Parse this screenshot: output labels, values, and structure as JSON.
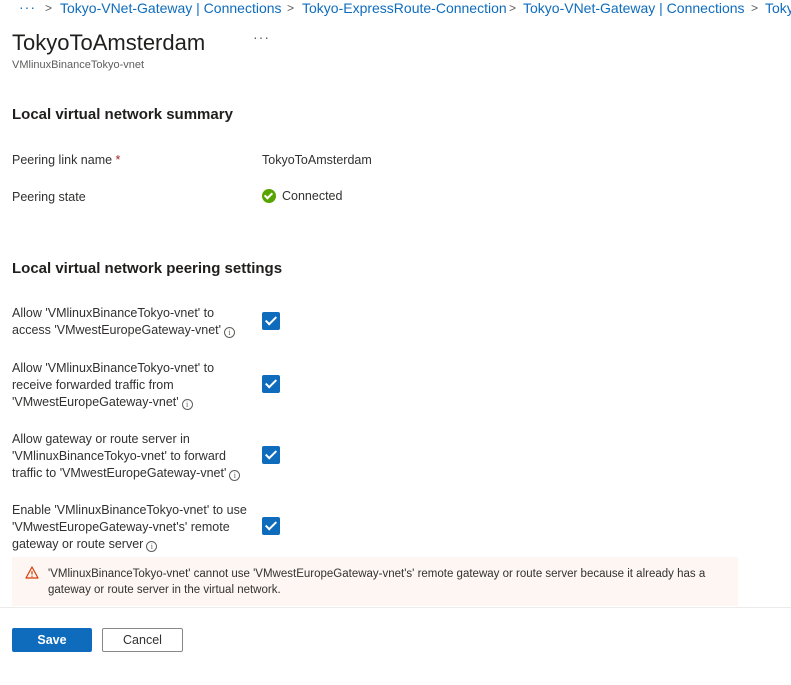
{
  "breadcrumb": {
    "ellipsis": "···",
    "items": [
      "Tokyo-VNet-Gateway | Connections",
      "Tokyo-ExpressRoute-Connection",
      "Tokyo-VNet-Gateway | Connections",
      "Tokyo"
    ]
  },
  "header": {
    "title": "TokyoToAmsterdam",
    "more": "···",
    "subtitle": "VMlinuxBinanceTokyo-vnet"
  },
  "summary": {
    "heading": "Local virtual network summary",
    "peering_link_label": "Peering link name",
    "required_mark": "*",
    "peering_link_value": "TokyoToAmsterdam",
    "peering_state_label": "Peering state",
    "peering_state_value": "Connected"
  },
  "settings": {
    "heading": "Local virtual network peering settings",
    "items": [
      {
        "label": "Allow 'VMlinuxBinanceTokyo-vnet' to access 'VMwestEuropeGateway-vnet'",
        "checked": true
      },
      {
        "label": "Allow 'VMlinuxBinanceTokyo-vnet' to receive forwarded traffic from 'VMwestEuropeGateway-vnet'",
        "checked": true
      },
      {
        "label": "Allow gateway or route server in 'VMlinuxBinanceTokyo-vnet' to forward traffic to 'VMwestEuropeGateway-vnet'",
        "checked": true
      },
      {
        "label": "Enable 'VMlinuxBinanceTokyo-vnet' to use 'VMwestEuropeGateway-vnet's' remote gateway or route server",
        "checked": true
      }
    ],
    "info_glyph": "i"
  },
  "warning": {
    "text": "'VMlinuxBinanceTokyo-vnet' cannot use 'VMwestEuropeGateway-vnet's' remote gateway or route server because it already has a gateway or route server in the virtual network."
  },
  "footer": {
    "save_label": "Save",
    "cancel_label": "Cancel"
  },
  "colors": {
    "accent": "#0f6cbd",
    "success": "#57a300",
    "warning_bg": "#fdf6f3",
    "warning_icon": "#d83b01"
  }
}
